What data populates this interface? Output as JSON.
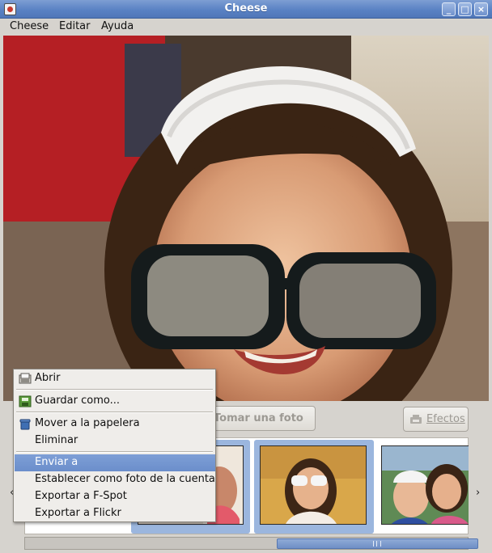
{
  "window": {
    "title": "Cheese"
  },
  "menubar": {
    "items": [
      "Cheese",
      "Editar",
      "Ayuda"
    ]
  },
  "toolbar": {
    "take_photo_label": "Tomar una foto",
    "effects_label": "Efectos"
  },
  "context_menu": {
    "items": [
      {
        "label": "Abrir",
        "icon": "open-folder-icon"
      },
      {
        "label": "Guardar como...",
        "icon": "save-as-icon"
      },
      {
        "label": "Mover a la papelera",
        "icon": "trash-icon"
      },
      {
        "label": "Eliminar",
        "icon": ""
      },
      {
        "label": "Enviar a",
        "icon": "",
        "highlighted": true
      },
      {
        "label": "Establecer como foto de la cuenta",
        "icon": ""
      },
      {
        "label": "Exportar a F-Spot",
        "icon": ""
      },
      {
        "label": "Exportar a Flickr",
        "icon": ""
      }
    ]
  },
  "strip": {
    "left_arrow": "‹",
    "right_arrow": "›"
  },
  "colors": {
    "accent": "#6b8ecb",
    "selection": "#9bb6de",
    "titlebar": "#5a82c4"
  }
}
